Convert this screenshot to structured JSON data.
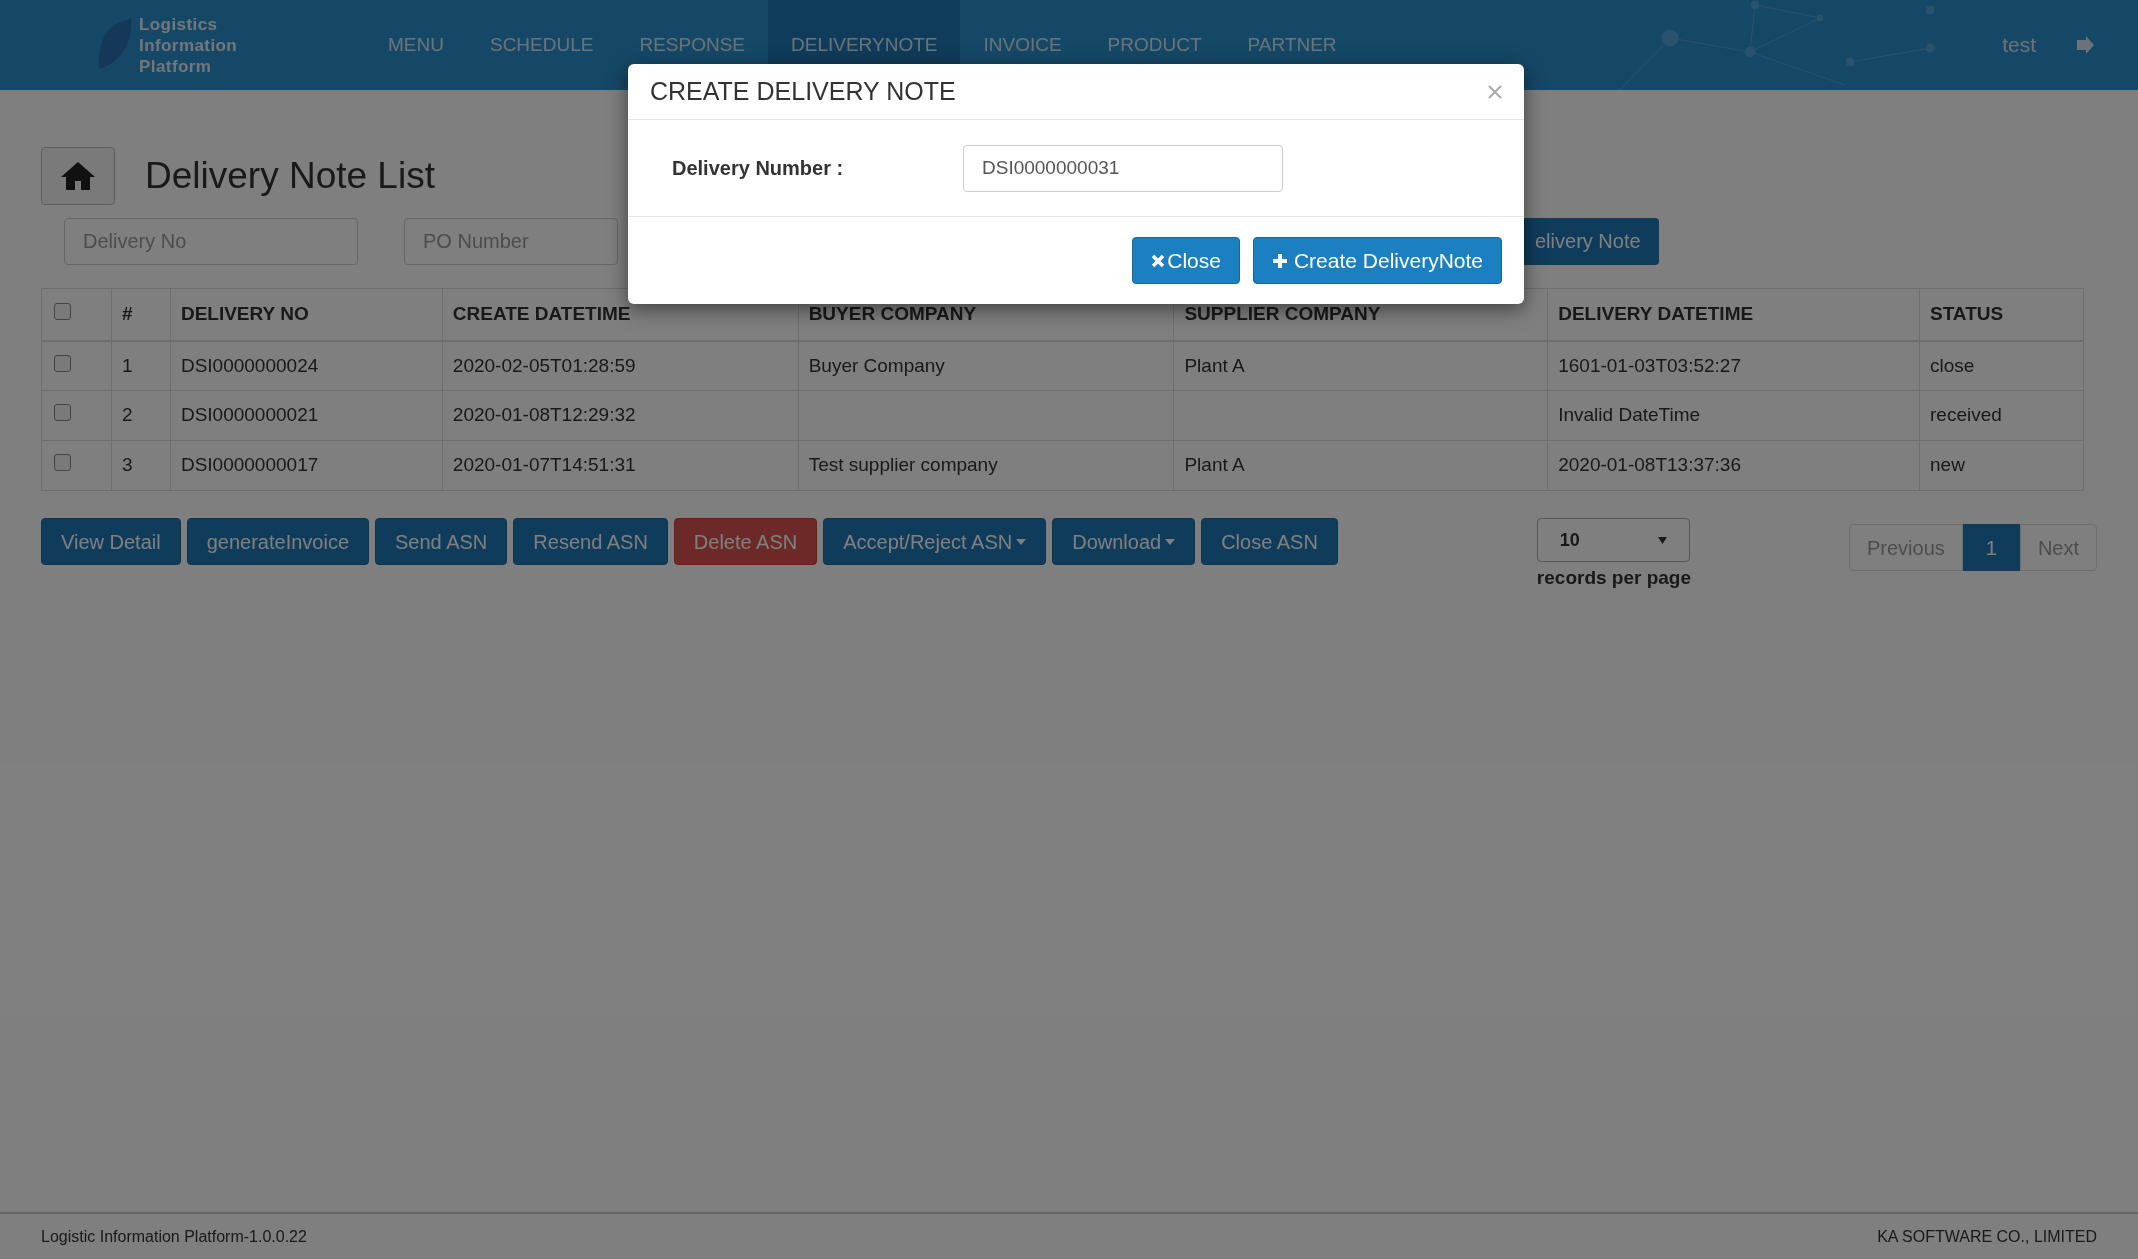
{
  "nav": {
    "logo_lines": [
      "Logistics",
      "Information",
      "Platform"
    ],
    "items": [
      {
        "label": "MENU",
        "selected": false
      },
      {
        "label": "SCHEDULE",
        "selected": false
      },
      {
        "label": "RESPONSE",
        "selected": false
      },
      {
        "label": "DELIVERYNOTE",
        "selected": true
      },
      {
        "label": "INVOICE",
        "selected": false
      },
      {
        "label": "PRODUCT",
        "selected": false
      },
      {
        "label": "PARTNER",
        "selected": false
      }
    ],
    "user": "test"
  },
  "page": {
    "title": "Delivery Note List",
    "filters": [
      {
        "placeholder": "Delivery No"
      },
      {
        "placeholder": "PO Number"
      }
    ],
    "partial_button": "elivery Note"
  },
  "table": {
    "header_checked": false,
    "columns": [
      "#",
      "DELIVERY NO",
      "CREATE DATETIME",
      "BUYER COMPANY",
      "SUPPLIER COMPANY",
      "DELIVERY DATETIME",
      "STATUS"
    ],
    "rows": [
      {
        "checked": false,
        "cells": [
          "1",
          "DSI0000000024",
          "2020-02-05T01:28:59",
          "Buyer Company",
          "Plant A",
          "1601-01-03T03:52:27",
          "close"
        ]
      },
      {
        "checked": false,
        "cells": [
          "2",
          "DSI0000000021",
          "2020-01-08T12:29:32",
          "",
          "",
          "Invalid DateTime",
          "received"
        ]
      },
      {
        "checked": false,
        "cells": [
          "3",
          "DSI0000000017",
          "2020-01-07T14:51:31",
          "Test supplier company",
          "Plant A",
          "2020-01-08T13:37:36",
          "new"
        ]
      }
    ]
  },
  "actions": [
    {
      "label": "View Detail",
      "kind": "primary",
      "dropdown": false
    },
    {
      "label": "generateInvoice",
      "kind": "primary",
      "dropdown": false
    },
    {
      "label": "Send ASN",
      "kind": "primary",
      "dropdown": false
    },
    {
      "label": "Resend ASN",
      "kind": "primary",
      "dropdown": false
    },
    {
      "label": "Delete ASN",
      "kind": "danger",
      "dropdown": false
    },
    {
      "label": "Accept/Reject ASN",
      "kind": "primary",
      "dropdown": true
    },
    {
      "label": "Download",
      "kind": "primary",
      "dropdown": true
    },
    {
      "label": "Close ASN",
      "kind": "primary",
      "dropdown": false
    }
  ],
  "page_size": {
    "value": "10",
    "label": "records per page"
  },
  "pagination": {
    "previous": {
      "label": "Previous",
      "disabled": true
    },
    "pages": [
      {
        "label": "1",
        "selected": true
      }
    ],
    "next": {
      "label": "Next",
      "disabled": true
    }
  },
  "footer": {
    "left": "Logistic Information Platform-1.0.0.22",
    "right": "KA SOFTWARE CO., LIMITED"
  },
  "modal": {
    "title": "CREATE DELIVERY NOTE",
    "field_label": "Delivery Number :",
    "field_value": "DSI0000000031",
    "buttons": [
      {
        "label": "Close",
        "kind": "close"
      },
      {
        "label": "Create DeliveryNote",
        "kind": "create"
      }
    ]
  }
}
